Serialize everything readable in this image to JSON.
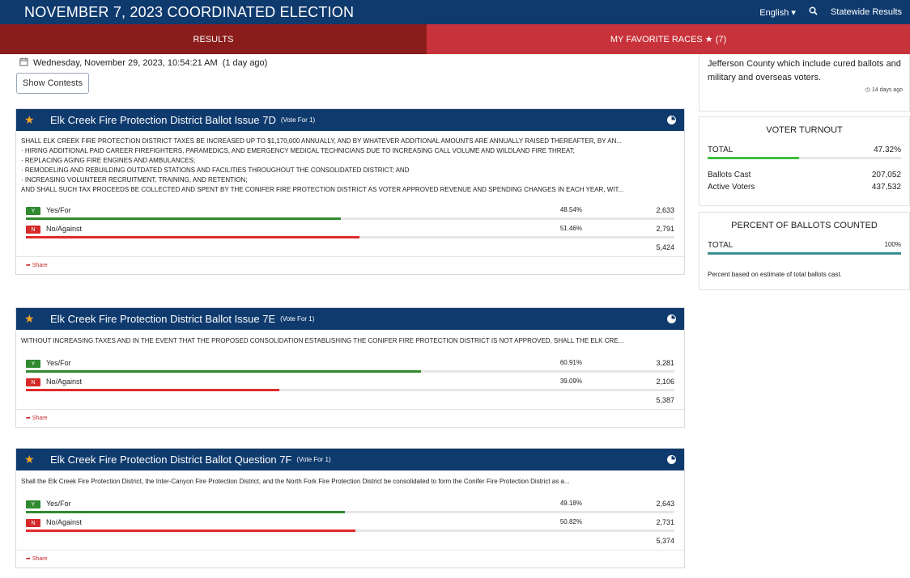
{
  "header": {
    "title": "NOVEMBER 7, 2023 COORDINATED ELECTION",
    "language": "English",
    "statewide": "Statewide Results"
  },
  "tabs": {
    "results": "RESULTS",
    "favorites": "MY FAVORITE RACES ★ (7)"
  },
  "updated": "Wednesday, November 29, 2023, 10:54:21 AM",
  "updated_ago": "(1 day ago)",
  "show_contests": "Show Contests",
  "contests": [
    {
      "name": "Elk Creek Fire Protection District Ballot Issue 7D",
      "vote_for": "(Vote For 1)",
      "description": [
        "SHALL ELK CREEK FIRE PROTECTION DISTRICT TAXES BE INCREASED UP TO $1,170,000 ANNUALLY, AND BY WHATEVER ADDITIONAL AMOUNTS ARE ANNUALLY RAISED THEREAFTER, BY AN...",
        "· HIRING ADDITIONAL PAID CAREER FIREFIGHTERS, PARAMEDICS, AND EMERGENCY MEDICAL TECHNICIANS DUE TO INCREASING CALL VOLUME AND WILDLAND FIRE THREAT;",
        "· REPLACING AGING FIRE ENGINES AND AMBULANCES;",
        "· REMODELING AND REBUILDING OUTDATED STATIONS AND FACILITIES THROUGHOUT THE CONSOLIDATED DISTRICT; AND",
        "· INCREASING VOLUNTEER RECRUITMENT, TRAINING, AND RETENTION;",
        "AND SHALL SUCH TAX PROCEEDS BE COLLECTED AND SPENT BY THE CONIFER FIRE PROTECTION DISTRICT AS VOTER APPROVED REVENUE AND SPENDING CHANGES IN EACH YEAR, WIT..."
      ],
      "choices": [
        {
          "badge": "Y",
          "label": "Yes/For",
          "pct_text": "48.54%",
          "pct": 48.54,
          "count": "2,633"
        },
        {
          "badge": "N",
          "label": "No/Against",
          "pct_text": "51.46%",
          "pct": 51.46,
          "count": "2,791"
        }
      ],
      "total": "5,424",
      "share": "Share"
    },
    {
      "name": "Elk Creek Fire Protection District Ballot Issue 7E",
      "vote_for": "(Vote For 1)",
      "description": [
        "WITHOUT INCREASING TAXES AND IN THE EVENT THAT THE PROPOSED CONSOLIDATION ESTABLISHING THE CONIFER FIRE PROTECTION DISTRICT IS NOT APPROVED, SHALL THE ELK CRE..."
      ],
      "choices": [
        {
          "badge": "Y",
          "label": "Yes/For",
          "pct_text": "60.91%",
          "pct": 60.91,
          "count": "3,281"
        },
        {
          "badge": "N",
          "label": "No/Against",
          "pct_text": "39.09%",
          "pct": 39.09,
          "count": "2,106"
        }
      ],
      "total": "5,387",
      "share": "Share"
    },
    {
      "name": "Elk Creek Fire Protection District Ballot Question 7F",
      "vote_for": "(Vote For 1)",
      "description": [
        "Shall the Elk Creek Fire Protection District, the Inter-Canyon Fire Protection District, and the North Fork Fire Protection District be consolidated to form the Conifer Fire Protection District as a..."
      ],
      "choices": [
        {
          "badge": "Y",
          "label": "Yes/For",
          "pct_text": "49.18%",
          "pct": 49.18,
          "count": "2,643"
        },
        {
          "badge": "N",
          "label": "No/Against",
          "pct_text": "50.82%",
          "pct": 50.82,
          "count": "2,731"
        }
      ],
      "total": "5,374",
      "share": "Share"
    }
  ],
  "sidebar": {
    "note": "Jefferson County which include cured ballots and military and overseas voters.",
    "note_ago": "14 days ago",
    "turnout": {
      "title": "VOTER TURNOUT",
      "total_label": "TOTAL",
      "total_value": "47.32%",
      "total_pct": 47.32,
      "ballots_label": "Ballots Cast",
      "ballots_value": "207,052",
      "voters_label": "Active Voters",
      "voters_value": "437,532"
    },
    "counted": {
      "title": "PERCENT OF BALLOTS COUNTED",
      "total_label": "TOTAL",
      "total_value": "100%",
      "total_pct": 100,
      "note": "Percent based on estimate of total ballots cast."
    }
  },
  "colors": {
    "navy": "#0f3a6e",
    "results_tab": "#8a1c1c",
    "favorites_tab": "#c8323a",
    "yes": "#2f8a2f",
    "no": "#e12b2b",
    "star": "#f5a623"
  }
}
